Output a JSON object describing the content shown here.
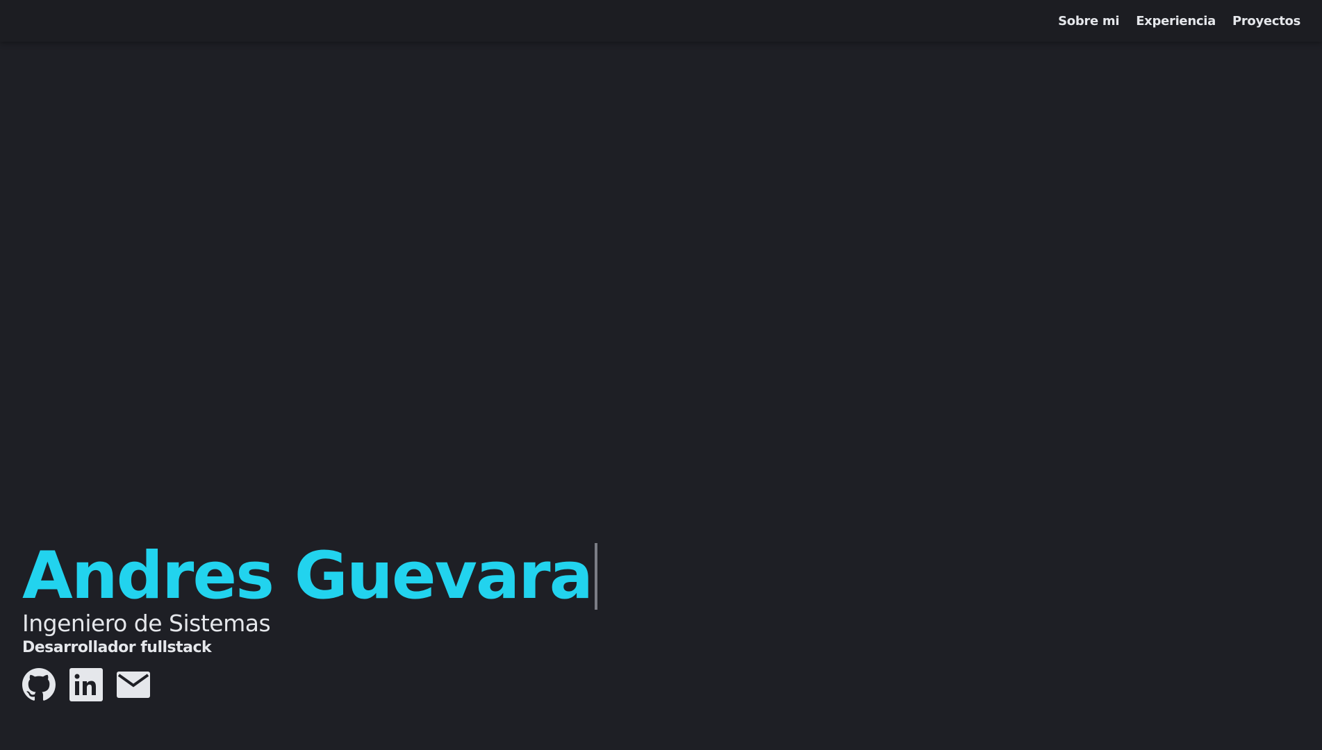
{
  "nav": {
    "items": [
      {
        "label": "Sobre mi"
      },
      {
        "label": "Experiencia"
      },
      {
        "label": "Proyectos"
      }
    ]
  },
  "hero": {
    "name": "Andres Guevara",
    "title": "Ingeniero de Sistemas",
    "subtitle": "Desarrollador fullstack",
    "socials": [
      {
        "icon": "github-icon"
      },
      {
        "icon": "linkedin-icon"
      },
      {
        "icon": "mail-icon"
      }
    ]
  },
  "colors": {
    "accent": "#22d3ee",
    "background": "#1e1f25",
    "header": "#1c1d22",
    "text": "#e5e7eb"
  }
}
